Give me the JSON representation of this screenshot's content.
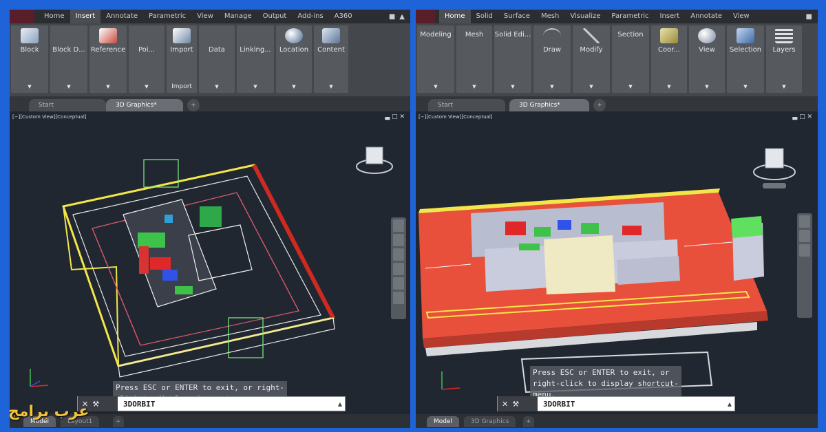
{
  "left": {
    "ribbon_tabs": [
      "Home",
      "Insert",
      "Annotate",
      "Parametric",
      "View",
      "Manage",
      "Output",
      "Add-ins",
      "A360"
    ],
    "active_tab": "Insert",
    "panels": [
      {
        "label": "Block",
        "icon": "block-icon"
      },
      {
        "label": "Block D...",
        "icon": "block-definition-icon"
      },
      {
        "label": "Reference",
        "icon": "reference-icon"
      },
      {
        "label": "Poi...",
        "icon": "point-cloud-icon"
      },
      {
        "label": "Import",
        "icon": "import-icon",
        "title": "Import"
      },
      {
        "label": "Data",
        "icon": "data-icon"
      },
      {
        "label": "Linking...",
        "icon": "linking-icon"
      },
      {
        "label": "Location",
        "icon": "globe-icon"
      },
      {
        "label": "Content",
        "icon": "content-icon"
      }
    ],
    "file_tabs": [
      "Start",
      "3D Graphics*"
    ],
    "viewport_label": "[−][Custom View][Conceptual]",
    "viewport_controls": "▃ □ ✕",
    "cmd_message": "Press ESC or ENTER to exit, or right-\nclick to display shortcut-menu.",
    "cmd_text": "3DORBIT",
    "layout_tabs": [
      "Model",
      "Layout1"
    ]
  },
  "right": {
    "ribbon_tabs": [
      "Home",
      "Solid",
      "Surface",
      "Mesh",
      "Visualize",
      "Parametric",
      "Insert",
      "Annotate",
      "View"
    ],
    "active_tab": "Home",
    "panels": [
      {
        "label": "Modeling",
        "icon": "modeling-icon"
      },
      {
        "label": "Mesh",
        "icon": "mesh-icon"
      },
      {
        "label": "Solid Edi...",
        "icon": "solid-editing-icon"
      },
      {
        "label": "Draw",
        "icon": "draw-icon"
      },
      {
        "label": "Modify",
        "icon": "modify-icon"
      },
      {
        "label": "Section",
        "icon": "section-icon"
      },
      {
        "label": "Coor...",
        "icon": "coordinates-icon"
      },
      {
        "label": "View",
        "icon": "view-icon"
      },
      {
        "label": "Selection",
        "icon": "selection-icon"
      },
      {
        "label": "Layers",
        "icon": "layers-icon"
      }
    ],
    "file_tabs": [
      "Start",
      "3D Graphics*"
    ],
    "viewport_label": "[−][Custom View][Conceptual]",
    "viewport_controls": "▃ □ ✕",
    "cmd_message": "Press ESC or ENTER to exit, or\nright-click to display shortcut-\nmenu.",
    "cmd_text": "3DORBIT",
    "layout_tabs": [
      "Model",
      "3D Graphics"
    ]
  },
  "watermark": "عرب برامج",
  "colors": {
    "frame": "#1f63d9",
    "viewport": "#212731",
    "ribbon": "#44474c",
    "accent_red": "#e8503c"
  }
}
